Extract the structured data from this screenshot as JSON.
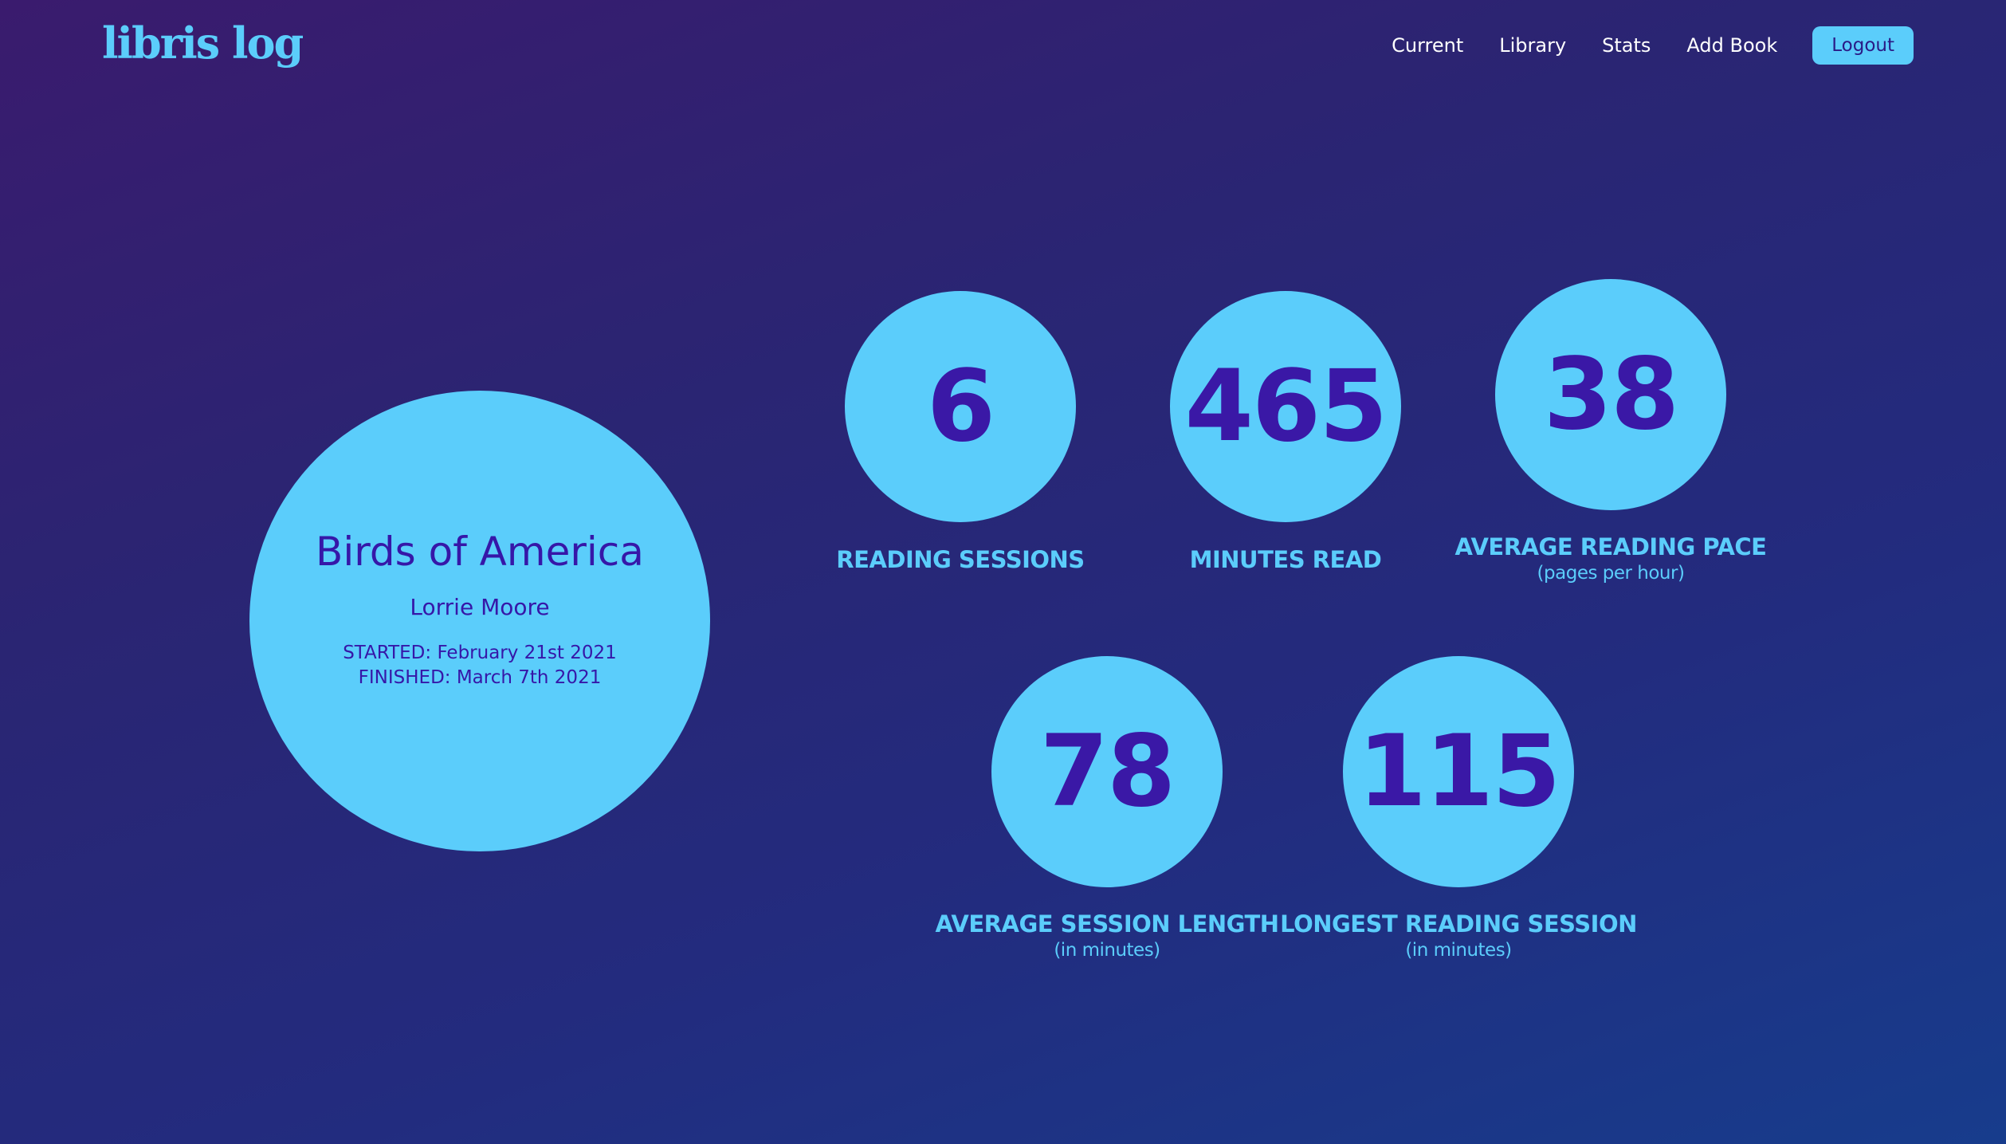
{
  "brand": {
    "logo": "libris log"
  },
  "nav": {
    "links": [
      "Current",
      "Library",
      "Stats",
      "Add Book"
    ],
    "logout": "Logout"
  },
  "book": {
    "title": "Birds of America",
    "author": "Lorrie Moore",
    "started": "STARTED: February 21st 2021",
    "finished": "FINISHED: March 7th 2021"
  },
  "stats": [
    {
      "value": "6",
      "label": "READING SESSIONS",
      "sub": ""
    },
    {
      "value": "465",
      "label": "MINUTES READ",
      "sub": ""
    },
    {
      "value": "38",
      "label": "AVERAGE READING PACE",
      "sub": "(pages per hour)"
    },
    {
      "value": "78",
      "label": "AVERAGE SESSION LENGTH",
      "sub": "(in minutes)"
    },
    {
      "value": "115",
      "label": "LONGEST READING SESSION",
      "sub": "(in minutes)"
    }
  ],
  "colors": {
    "accent": "#5bcdfb",
    "ink": "#3617a8",
    "background_start": "#3a1b6e",
    "background_end": "#173c8c"
  }
}
